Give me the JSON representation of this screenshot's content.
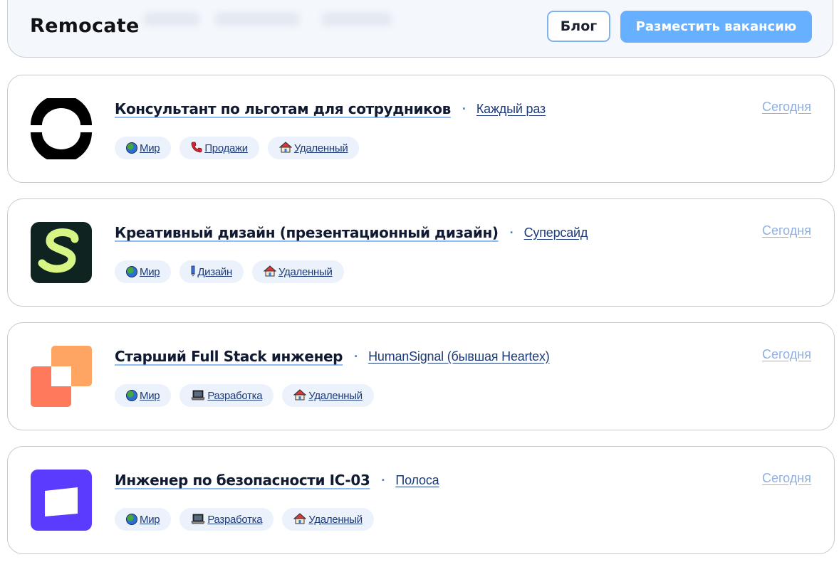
{
  "header": {
    "logo": "Remocate",
    "blog_label": "Блог",
    "post_job_label": "Разместить вакансию"
  },
  "jobs": [
    {
      "title": "Консультант по льготам для сотрудников",
      "company": "Каждый раз",
      "date": "Сегодня",
      "logo_icon": "half-rings-logo-icon",
      "tags": [
        {
          "icon": "globe-icon",
          "label": "Мир"
        },
        {
          "icon": "phone-icon",
          "label": "Продажи"
        },
        {
          "icon": "house-icon",
          "label": "Удаленный"
        }
      ]
    },
    {
      "title": "Креативный дизайн (презентационный дизайн)",
      "company": "Суперсайд",
      "date": "Сегодня",
      "logo_icon": "s-letter-logo-icon",
      "tags": [
        {
          "icon": "globe-icon",
          "label": "Мир"
        },
        {
          "icon": "pencil-icon",
          "label": "Дизайн"
        },
        {
          "icon": "house-icon",
          "label": "Удаленный"
        }
      ]
    },
    {
      "title": "Старший Full Stack инженер",
      "company": "HumanSignal (бывшая Heartex)",
      "date": "Сегодня",
      "logo_icon": "squares-logo-icon",
      "tags": [
        {
          "icon": "globe-icon",
          "label": "Мир"
        },
        {
          "icon": "laptop-icon",
          "label": "Разработка"
        },
        {
          "icon": "house-icon",
          "label": "Удаленный"
        }
      ]
    },
    {
      "title": "Инженер по безопасности IC-03",
      "company": "Полоса",
      "date": "Сегодня",
      "logo_icon": "stripe-logo-icon",
      "tags": [
        {
          "icon": "globe-icon",
          "label": "Мир"
        },
        {
          "icon": "laptop-icon",
          "label": "Разработка"
        },
        {
          "icon": "house-icon",
          "label": "Удаленный"
        }
      ]
    }
  ],
  "colors": {
    "accent": "#67b0ff",
    "tag_bg": "#ecf2fb",
    "link": "#1d3a7a",
    "date": "#8fb0e0"
  }
}
